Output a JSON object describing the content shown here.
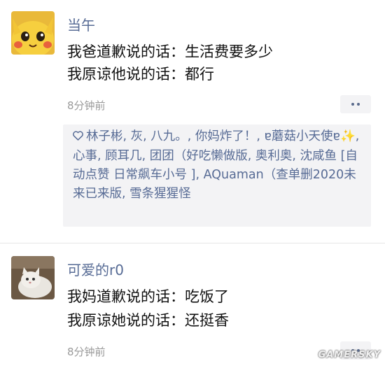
{
  "posts": [
    {
      "user": "当午",
      "lines": [
        "我爸道歉说的话：生活费要多少",
        "我原谅他说的话：都行"
      ],
      "time": "8分钟前",
      "likes": "林子彬, 灰, 八九。, 你妈炸了！, ɐ蘑菇小天使ɐ✨, 心事, 顾耳几, 团团（好吃懒做版, 奥利奥, 沈咸鱼 [自动点赞 日常飙车小号 ], AQuaman（查单删2020未来已来版, 雪条猩猩怪"
    },
    {
      "user": "可爱的r0",
      "lines": [
        "我妈道歉说的话：吃饭了",
        "我原谅她说的话：还挺香"
      ],
      "time": "8分钟前"
    }
  ],
  "watermark": "GAMERSKY",
  "colors": {
    "name": "#576b95",
    "time": "#9a9a9a",
    "likes_bg": "#f3f3f5"
  }
}
